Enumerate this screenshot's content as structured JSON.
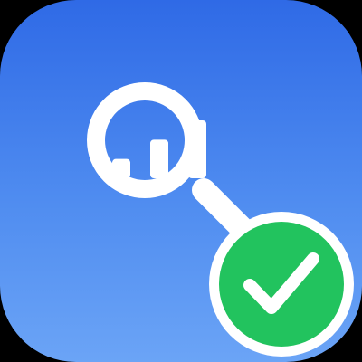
{
  "app_icon": {
    "icons": {
      "main": "magnifier-analytics-icon",
      "bars": "bar-chart-icon",
      "badge": "checkmark-badge-icon"
    },
    "colors": {
      "background_top": "#2F6AE6",
      "background_bottom": "#6BA4F6",
      "glyph": "#FFFFFF",
      "badge_fill": "#22C35E",
      "badge_border": "#FFFFFF"
    },
    "chart": {
      "bar_values": [
        1,
        2,
        3
      ]
    },
    "status": "verified"
  }
}
